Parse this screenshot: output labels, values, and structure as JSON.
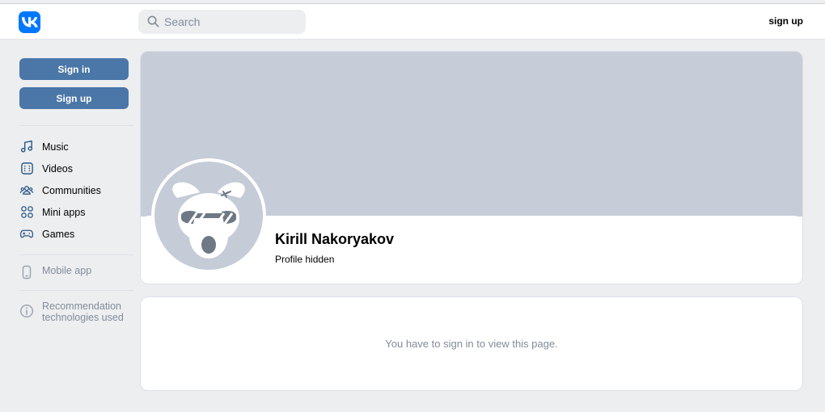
{
  "header": {
    "search_placeholder": "Search",
    "signup_link": "sign up"
  },
  "sidebar": {
    "sign_in": "Sign in",
    "sign_up": "Sign up",
    "items": [
      {
        "label": "Music",
        "icon": "music-note-icon"
      },
      {
        "label": "Videos",
        "icon": "video-icon"
      },
      {
        "label": "Communities",
        "icon": "communities-icon"
      },
      {
        "label": "Mini apps",
        "icon": "mini-apps-icon"
      },
      {
        "label": "Games",
        "icon": "gamepad-icon"
      }
    ],
    "mobile_app": "Mobile app",
    "recommendation_line1": "Recommendation",
    "recommendation_line2": "technologies used"
  },
  "profile": {
    "name": "Kirill Nakoryakov",
    "status": "Profile hidden"
  },
  "message": "You have to sign in to view this page.",
  "colors": {
    "brand": "#0077ff",
    "button": "#4a76a8",
    "cover": "#c6ccd8",
    "background": "#edeef0",
    "muted_text": "#818c99"
  }
}
